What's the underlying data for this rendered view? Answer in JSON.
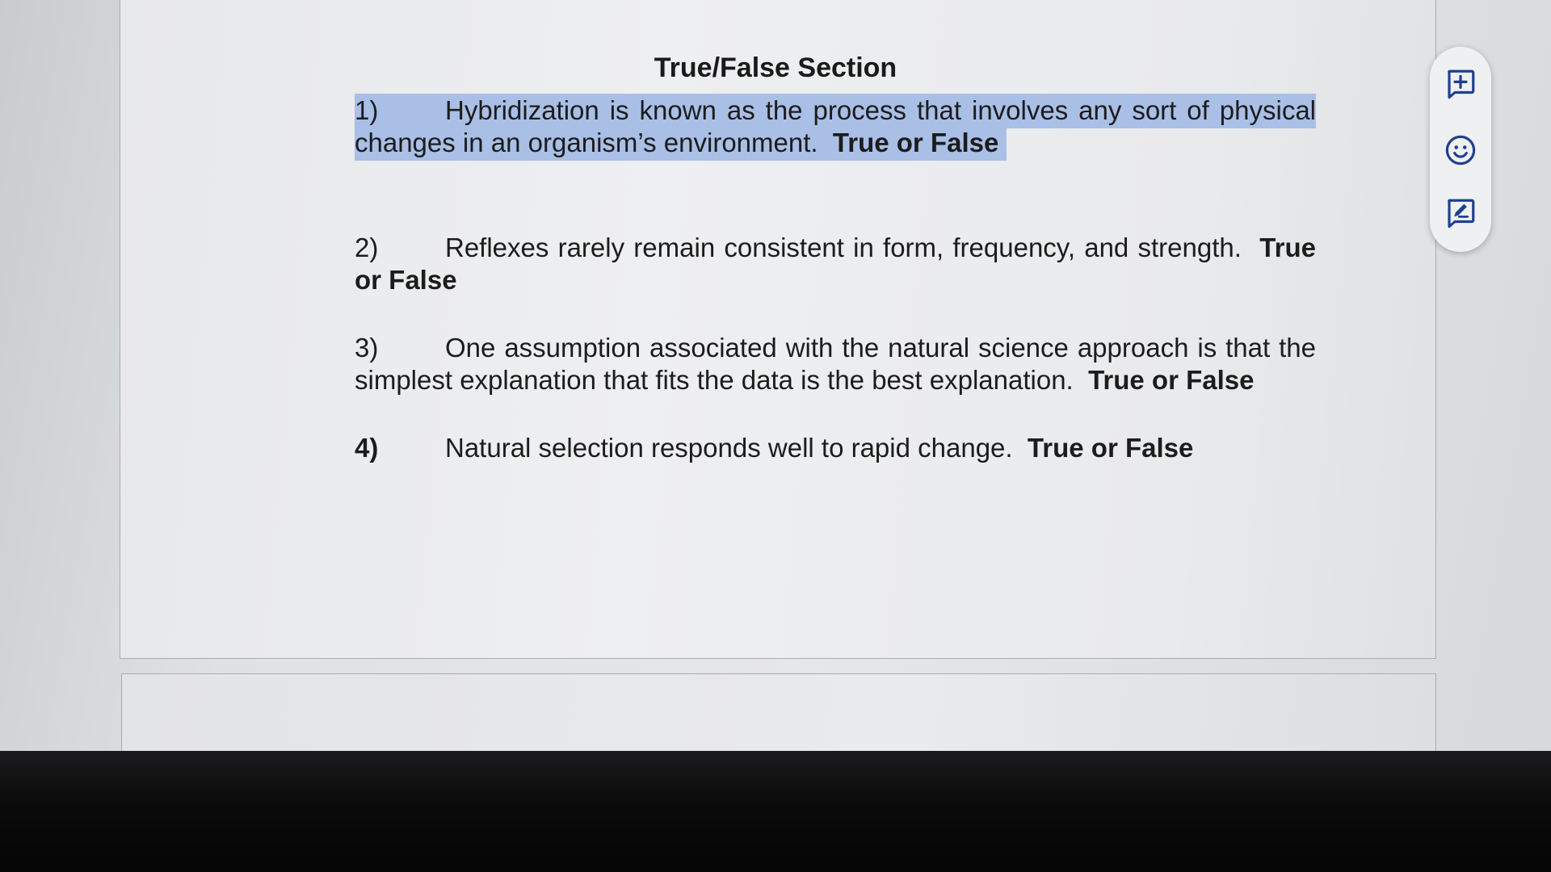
{
  "document": {
    "section_title": "True/False Section",
    "questions": [
      {
        "number": "1)",
        "text": "Hybridization is known as the process that involves any sort of physical changes in an organism’s environment.",
        "answer_prompt": "True or False",
        "selected": true
      },
      {
        "number": "2)",
        "text": "Reflexes rarely remain consistent in form, frequency, and strength.",
        "answer_prompt": "True or False",
        "selected": false
      },
      {
        "number": "3)",
        "text": "One assumption associated with the natural science approach is that the simplest explanation that fits the data is the best explanation.",
        "answer_prompt": "True or False",
        "selected": false
      },
      {
        "number": "4)",
        "text": "Natural selection responds well to rapid change.",
        "answer_prompt": "True or False",
        "selected": false
      }
    ]
  },
  "side_toolbar": {
    "items": [
      {
        "icon": "add-comment-icon"
      },
      {
        "icon": "emoji-reaction-icon"
      },
      {
        "icon": "suggest-edits-icon"
      }
    ]
  },
  "colors": {
    "selection_highlight": "#a9bfe6",
    "page_background": "#eeeff0",
    "toolbar_icon": "#1f3f8f"
  }
}
